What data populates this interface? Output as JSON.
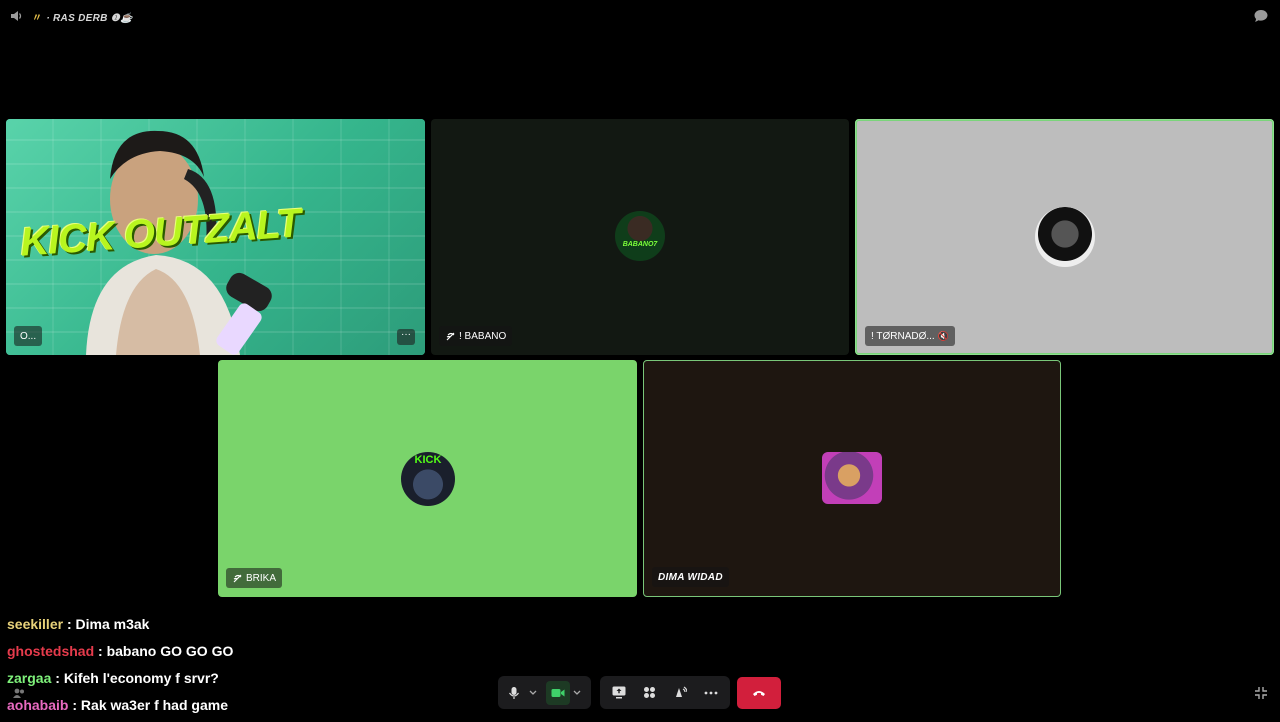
{
  "server": {
    "name": "RAS DERB",
    "emoji": "❶☕",
    "tag": "〃"
  },
  "tiles": [
    {
      "name": "O...",
      "more": "···"
    },
    {
      "name": "! BABANO",
      "avatar_text": "BABANO7"
    },
    {
      "name": "! TØRNADØ...",
      "muted_icon": "🔇"
    },
    {
      "name": "BRIKA",
      "avatar_text": "KICK"
    },
    {
      "name": "DIMA WIDAD"
    }
  ],
  "cam_overlay": "KICK OUTZALT",
  "chat": [
    {
      "user": "seekiller",
      "color": "#e8d27a",
      "message": "Dima m3ak"
    },
    {
      "user": "ghostedshad",
      "color": "#e63b4c",
      "message": "babano GO GO GO"
    },
    {
      "user": "zargaa",
      "color": "#7ef07a",
      "message": "Kifeh l'economy f srvr?"
    },
    {
      "user": "aohabaib",
      "color": "#e86ac0",
      "message": "Rak wa3er f had game"
    }
  ],
  "colors": {
    "accent_speaking": "#8fe08f",
    "leave": "#d21f3c"
  }
}
